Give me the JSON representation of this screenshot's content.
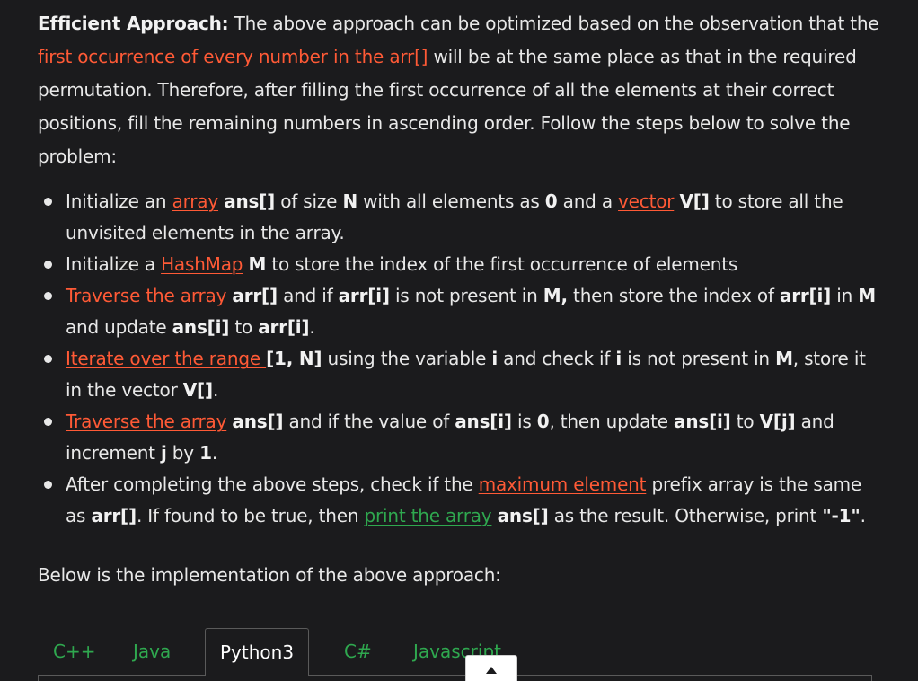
{
  "intro": {
    "heading": "Efficient Approach:",
    "t1": " The above approach can be optimized based on the observation that the ",
    "link1": "first occurrence of every number in the arr[]",
    "t2": " will be at the same place as that in the required permutation. Therefore, after filling the first occurrence of all the elements at their correct positions, fill the remaining numbers in ascending order. Follow the steps below to solve the problem:"
  },
  "steps": [
    {
      "a": "Initialize an ",
      "link_array": "array",
      "b": " ",
      "ans": "ans[]",
      "c": " of size ",
      "n": "N",
      "d": " with all elements as ",
      "zero": "0",
      "e": " and a ",
      "link_vector": "vector",
      "f": " ",
      "v": "V[]",
      "g": " to store all the unvisited elements in the array."
    },
    {
      "a": "Initialize a ",
      "link": "HashMap",
      "b": " ",
      "m": "M",
      "c": " to store the index of the first occurrence of elements"
    },
    {
      "link": "Traverse the array",
      "a": " ",
      "arr": "arr[]",
      "b": " and if ",
      "arri": "arr[i]",
      "c": " is not present in ",
      "m": "M,",
      "d": " then store the index of ",
      "arri2": "arr[i]",
      "e": " in ",
      "m2": "M",
      "f": " and update ",
      "ansi": "ans[i]",
      "g": " to ",
      "arri3": "arr[i]",
      "h": "."
    },
    {
      "link": "Iterate over the range ",
      "range": "[1, N]",
      "a": " using the variable ",
      "i": "i",
      "b": " and check if ",
      "i2": "i",
      "c": " is not present in ",
      "m": "M",
      "d": ", store it in the vector ",
      "v": "V[]",
      "e": "."
    },
    {
      "link": "Traverse the array",
      "a": " ",
      "ans": "ans[]",
      "b": " and if the value of ",
      "ansi": "ans[i]",
      "c": " is ",
      "zero": "0",
      "d": ", then update ",
      "ansi2": "ans[i]",
      "e": " to ",
      "vj": "V[j]",
      "f": " and increment ",
      "j": "j",
      "g": " by ",
      "one": "1",
      "h": "."
    },
    {
      "a": "After completing the above steps, check if the ",
      "link": "maximum element",
      "b": " prefix array is the same as ",
      "arr": "arr[]",
      "c": ". If found to be true, then ",
      "link_green": "print the array",
      "d": " ",
      "ans": "ans[]",
      "e": " as the result. Otherwise, print ",
      "neg": "\"-1\"",
      "f": "."
    }
  ],
  "below": "Below is the implementation of the above approach:",
  "tabs": [
    {
      "label": "C++"
    },
    {
      "label": "Java"
    },
    {
      "label": "Python3"
    },
    {
      "label": "C#"
    },
    {
      "label": "Javascript"
    }
  ],
  "active_tab": "Python3",
  "colors": {
    "background": "#1b1b1d",
    "text": "#e8e8e8",
    "link": "#ff5a36",
    "link_green": "#2fa84f",
    "tab_text": "#2fa84f",
    "tab_active_text": "#ffffff",
    "tab_border": "#5a5a5a"
  },
  "icons": {
    "tooltip_caret": "caret-up-icon"
  }
}
